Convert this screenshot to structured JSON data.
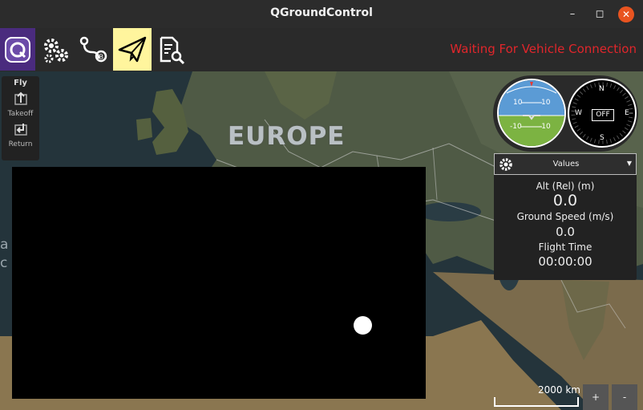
{
  "window": {
    "title": "QGroundControl",
    "minimize_icon": "minimize-icon",
    "maximize_icon": "maximize-icon",
    "close_icon": "close-icon"
  },
  "toolbar": {
    "buttons": [
      {
        "name": "app-menu",
        "icon": "qgc-logo-icon"
      },
      {
        "name": "vehicle-setup",
        "icon": "gears-icon"
      },
      {
        "name": "plan-flight",
        "icon": "plan-route-icon"
      },
      {
        "name": "fly-view",
        "icon": "paper-plane-icon",
        "active": true
      },
      {
        "name": "analyze",
        "icon": "document-search-icon"
      }
    ],
    "status_text": "Waiting For Vehicle Connection",
    "status_color": "#e0262b",
    "active_color": "#fff59d",
    "logo_bg": "#4a2b7e"
  },
  "map": {
    "region_label": "EUROPE",
    "edge_text_top": "a",
    "edge_text_bottom": "c",
    "scale_label": "2000 km",
    "zoom_in": "+",
    "zoom_out": "-"
  },
  "fly_panel": {
    "header": "Fly",
    "items": [
      {
        "label": "Takeoff",
        "icon": "takeoff-icon"
      },
      {
        "label": "Return",
        "icon": "return-icon"
      }
    ]
  },
  "instruments": {
    "attitude": {
      "pitch_up_left": "10",
      "pitch_up_right": "10",
      "pitch_down_left": "-10",
      "pitch_down_right": "-10"
    },
    "compass": {
      "n": "N",
      "w": "W",
      "e": "E",
      "s": "S",
      "heading_text": "OFF"
    }
  },
  "values_panel": {
    "title": "Values",
    "rows": [
      {
        "label": "Alt (Rel) (m)",
        "value": "0.0"
      },
      {
        "label": "Ground Speed (m/s)",
        "value": "0.0"
      },
      {
        "label": "Flight Time",
        "value": "00:00:00"
      }
    ]
  }
}
